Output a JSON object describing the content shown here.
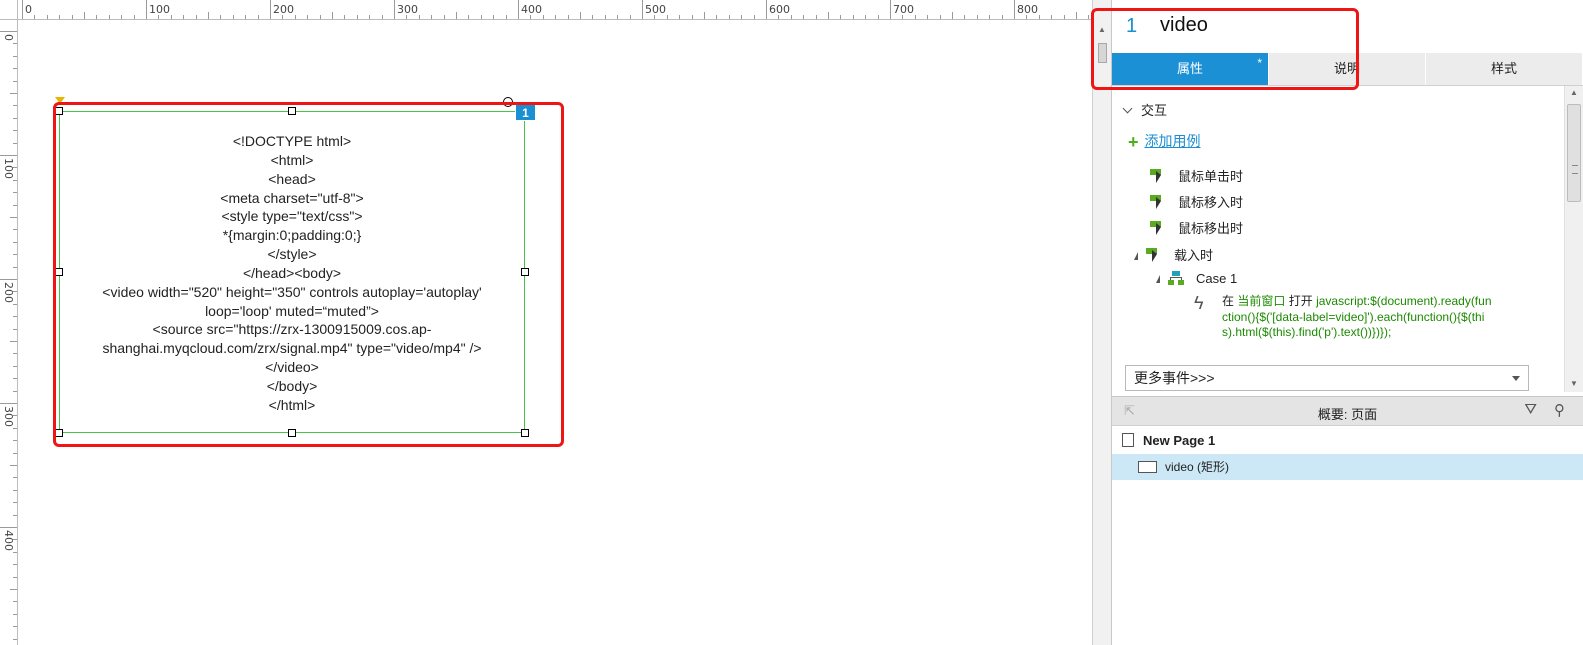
{
  "ruler": {
    "h_labels": [
      "0",
      "100",
      "200",
      "300",
      "400",
      "500",
      "600",
      "700",
      "800"
    ],
    "v_labels": [
      "0",
      "100",
      "200",
      "300",
      "400"
    ]
  },
  "widget": {
    "badge": "1",
    "text_lines": [
      "<!DOCTYPE html>",
      "<html>",
      "<head>",
      "<meta charset=\"utf-8\">",
      "<style type=\"text/css\">",
      "*{margin:0;padding:0;}",
      "</style>",
      "</head><body>",
      "<video width=\"520\" height=\"350\" controls autoplay='autoplay'",
      "loop='loop' muted=“muted”>",
      "<source src=\"https://zrx-1300915009.cos.ap-",
      "shanghai.myqcloud.com/zrx/signal.mp4\" type=\"video/mp4\" />",
      "</video>",
      "</body>",
      "</html>"
    ]
  },
  "panel": {
    "widget_number": "1",
    "widget_name": "video",
    "tabs": [
      {
        "label": "属性",
        "active": true,
        "marker": "*"
      },
      {
        "label": "说明",
        "active": false,
        "marker": ""
      },
      {
        "label": "样式",
        "active": false,
        "marker": ""
      }
    ],
    "interaction": {
      "heading": "交互",
      "add_case": "添加用例",
      "events": [
        "鼠标单击时",
        "鼠标移入时",
        "鼠标移出时",
        "载入时"
      ],
      "case_label": "Case 1",
      "action": {
        "prefix": "在",
        "target": "当前窗口",
        "verb": "打开",
        "script": "javascript:$(document).ready(function(){$('[data-label=video]').each(function(){$(this).html($(this).find('p').text())})});"
      },
      "more_events": "更多事件>>>"
    },
    "outline": {
      "title": "概要: 页面",
      "page_name": "New Page 1",
      "widget_item": "video (矩形)"
    }
  },
  "colors": {
    "accent": "#1c90d4",
    "highlight_red": "#ef1515",
    "selection_green": "#49c44b",
    "event_green": "#5aaa22"
  }
}
